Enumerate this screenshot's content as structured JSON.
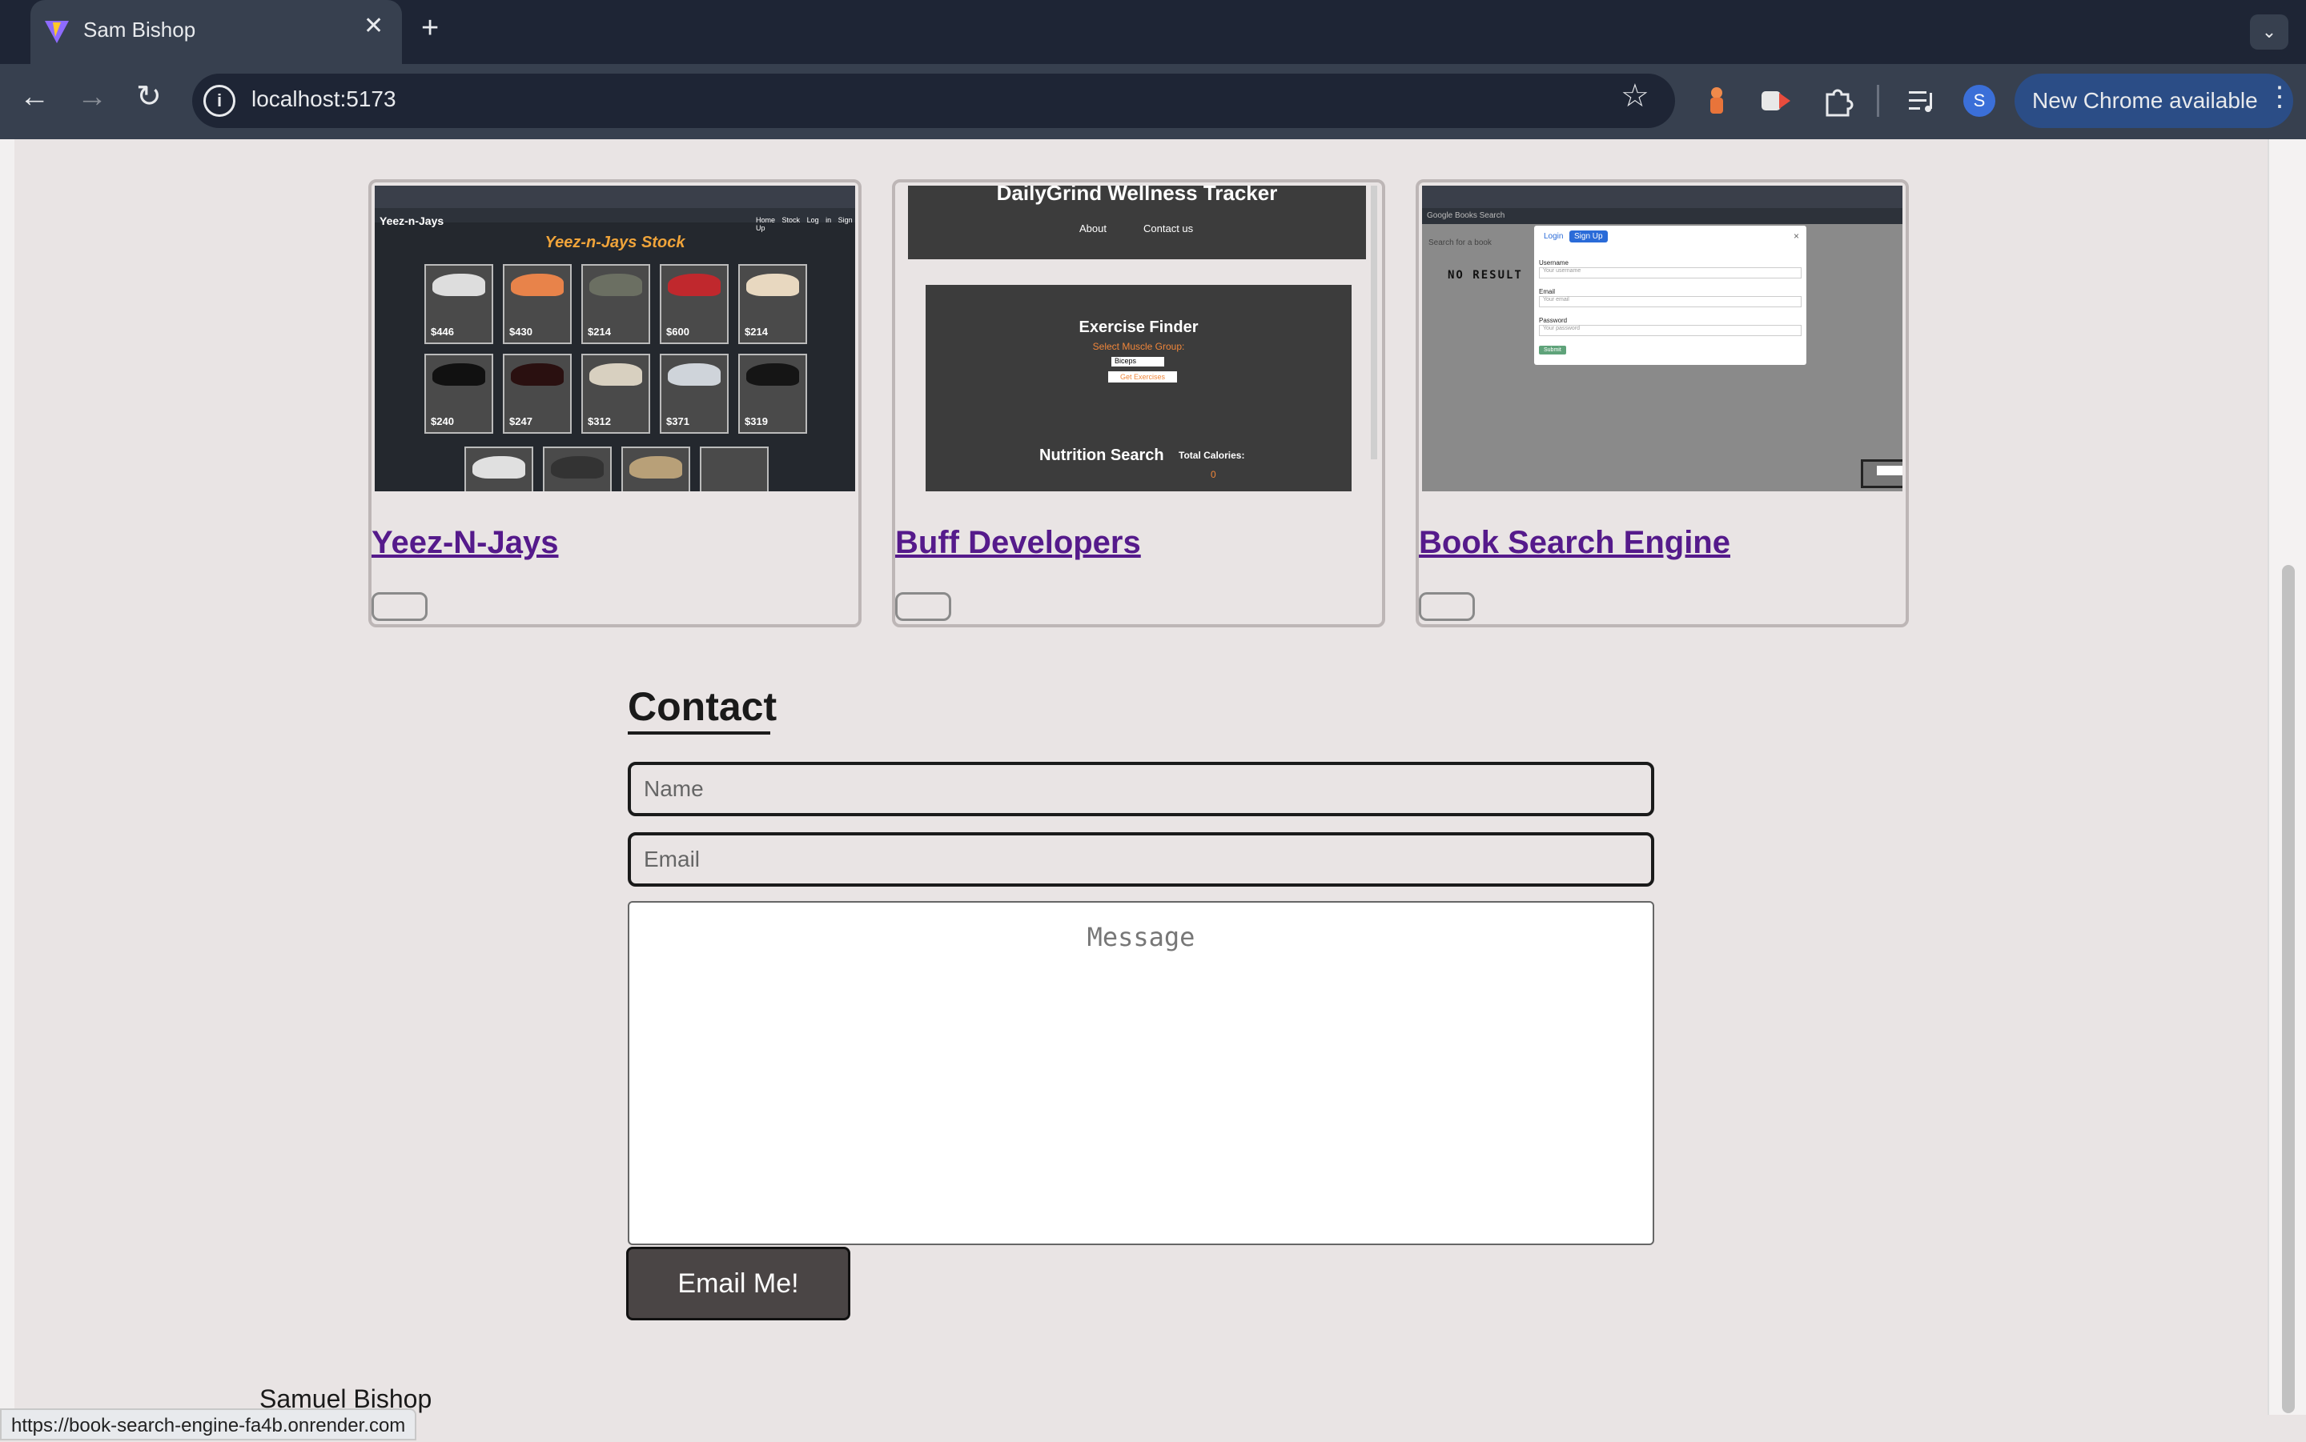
{
  "browser": {
    "tab_title": "Sam Bishop",
    "url": "localhost:5173",
    "update_label": "New Chrome available",
    "profile_initial": "S",
    "status_url": "https://book-search-engine-fa4b.onrender.com"
  },
  "projects": [
    {
      "title": "Yeez-N-Jays",
      "screenshot": {
        "brand": "Yeez-n-Jays",
        "heading": "Yeez-n-Jays Stock",
        "nav": [
          "Home",
          "Stock",
          "Log in",
          "Sign Up"
        ],
        "prices": [
          "$446",
          "$430",
          "$214",
          "$600",
          "$214",
          "$240",
          "$247",
          "$312",
          "$371",
          "$319"
        ]
      }
    },
    {
      "title": "Buff Developers",
      "screenshot": {
        "app_title": "DailyGrind Wellness Tracker",
        "nav": [
          "About",
          "Contact us"
        ],
        "exercise_heading": "Exercise Finder",
        "muscle_label": "Select Muscle Group:",
        "muscle_option": "Biceps",
        "get_button": "Get Exercises",
        "nutrition_heading": "Nutrition Search",
        "calories_label": "Total Calories:",
        "calories_value": "0"
      }
    },
    {
      "title": "Book Search Engine",
      "screenshot": {
        "brand": "Google Books Search",
        "search_placeholder": "Search for a book",
        "no_results": "NO RESULT",
        "login_tab": "Login",
        "signup_tab": "Sign Up",
        "username_label": "Username",
        "username_placeholder": "Your username",
        "email_label": "Email",
        "email_placeholder": "Your email",
        "password_label": "Password",
        "password_placeholder": "Your password",
        "submit": "Submit"
      }
    }
  ],
  "contact": {
    "heading": "Contact",
    "name_placeholder": "Name",
    "email_placeholder": "Email",
    "message_placeholder": "Message",
    "submit_label": "Email Me!"
  },
  "footer": {
    "name": "Samuel Bishop"
  },
  "colors": {
    "page_bg": "#e9e4e4",
    "link": "#551a8b",
    "chrome_dark": "#1e2535",
    "chrome_toolbar": "#37404f",
    "button_bg": "#4a4545"
  },
  "icons": [
    "vite-favicon",
    "close-icon",
    "plus-icon",
    "chevron-down-icon",
    "back-arrow-icon",
    "forward-arrow-icon",
    "reload-icon",
    "site-info-icon",
    "star-icon",
    "extension-icons",
    "puzzle-icon",
    "media-icon",
    "more-vert-icon"
  ]
}
